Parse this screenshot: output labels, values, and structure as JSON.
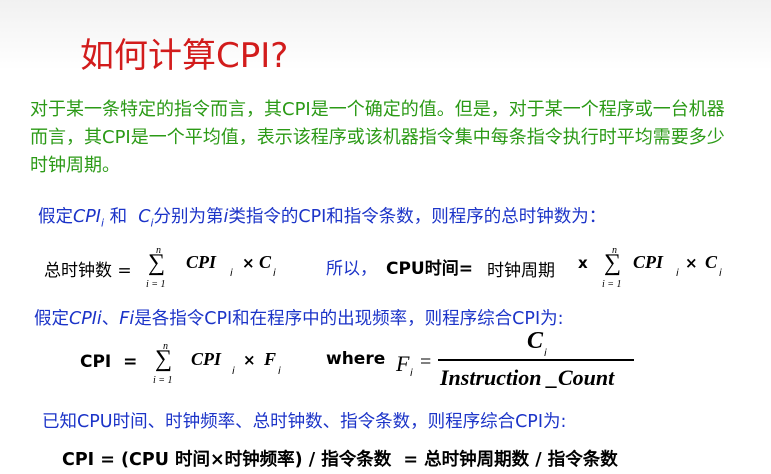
{
  "title": "如何计算CPI?",
  "intro": "对于某一条特定的指令而言，其CPI是一个确定的值。但是，对于某一个程序或一台机器而言，其CPI是一个平均值，表示该程序或该机器指令集中每条指令执行时平均需要多少时钟周期。",
  "assume1": {
    "prefix": "假定",
    "cpi": "CPI",
    "sub_i": "i",
    "and": " 和  ",
    "c": "C",
    "mid": "分别为第",
    "i": "i",
    "suffix": "类指令的CPI和指令条数，则程序的总时钟数为："
  },
  "formula1": {
    "lhs": "总时钟数 =",
    "n": "n",
    "sigma": "∑",
    "i1": "i = 1",
    "cpi": "CPI",
    "sub_i": "i",
    "times": "×",
    "c": "C",
    "sub_i2": "i"
  },
  "formula2": {
    "so": "所以，",
    "cpu": "CPU时间=",
    "clock": "时钟周期",
    "times": "x",
    "n": "n",
    "sigma": "∑",
    "i1": "i = 1",
    "cpi": "CPI",
    "sub_i": "i",
    "times2": "×",
    "c": "C",
    "sub_i2": "i"
  },
  "assume2": {
    "prefix": "假定",
    "cpi": "CPIi",
    "sep": "、",
    "f": "Fi",
    "suffix": "是各指令CPI和在程序中的出现频率，则程序综合CPI为:"
  },
  "formula3": {
    "lhs": "CPI  =",
    "n": "n",
    "sigma": "∑",
    "i1": "i = 1",
    "cpi": "CPI",
    "sub_i": "i",
    "times": "×",
    "f": "F",
    "sub_i2": "i",
    "where": "where",
    "fi": "F",
    "fi_sub": "i",
    "eq": "=",
    "num": "C",
    "num_sub": "i",
    "den": "Instruction _Count"
  },
  "known": "已知CPU时间、时钟频率、总时钟数、指令条数，则程序综合CPI为:",
  "final": "CPI = (CPU 时间×时钟频率) / 指令条数  = 总时钟周期数 / 指令条数"
}
